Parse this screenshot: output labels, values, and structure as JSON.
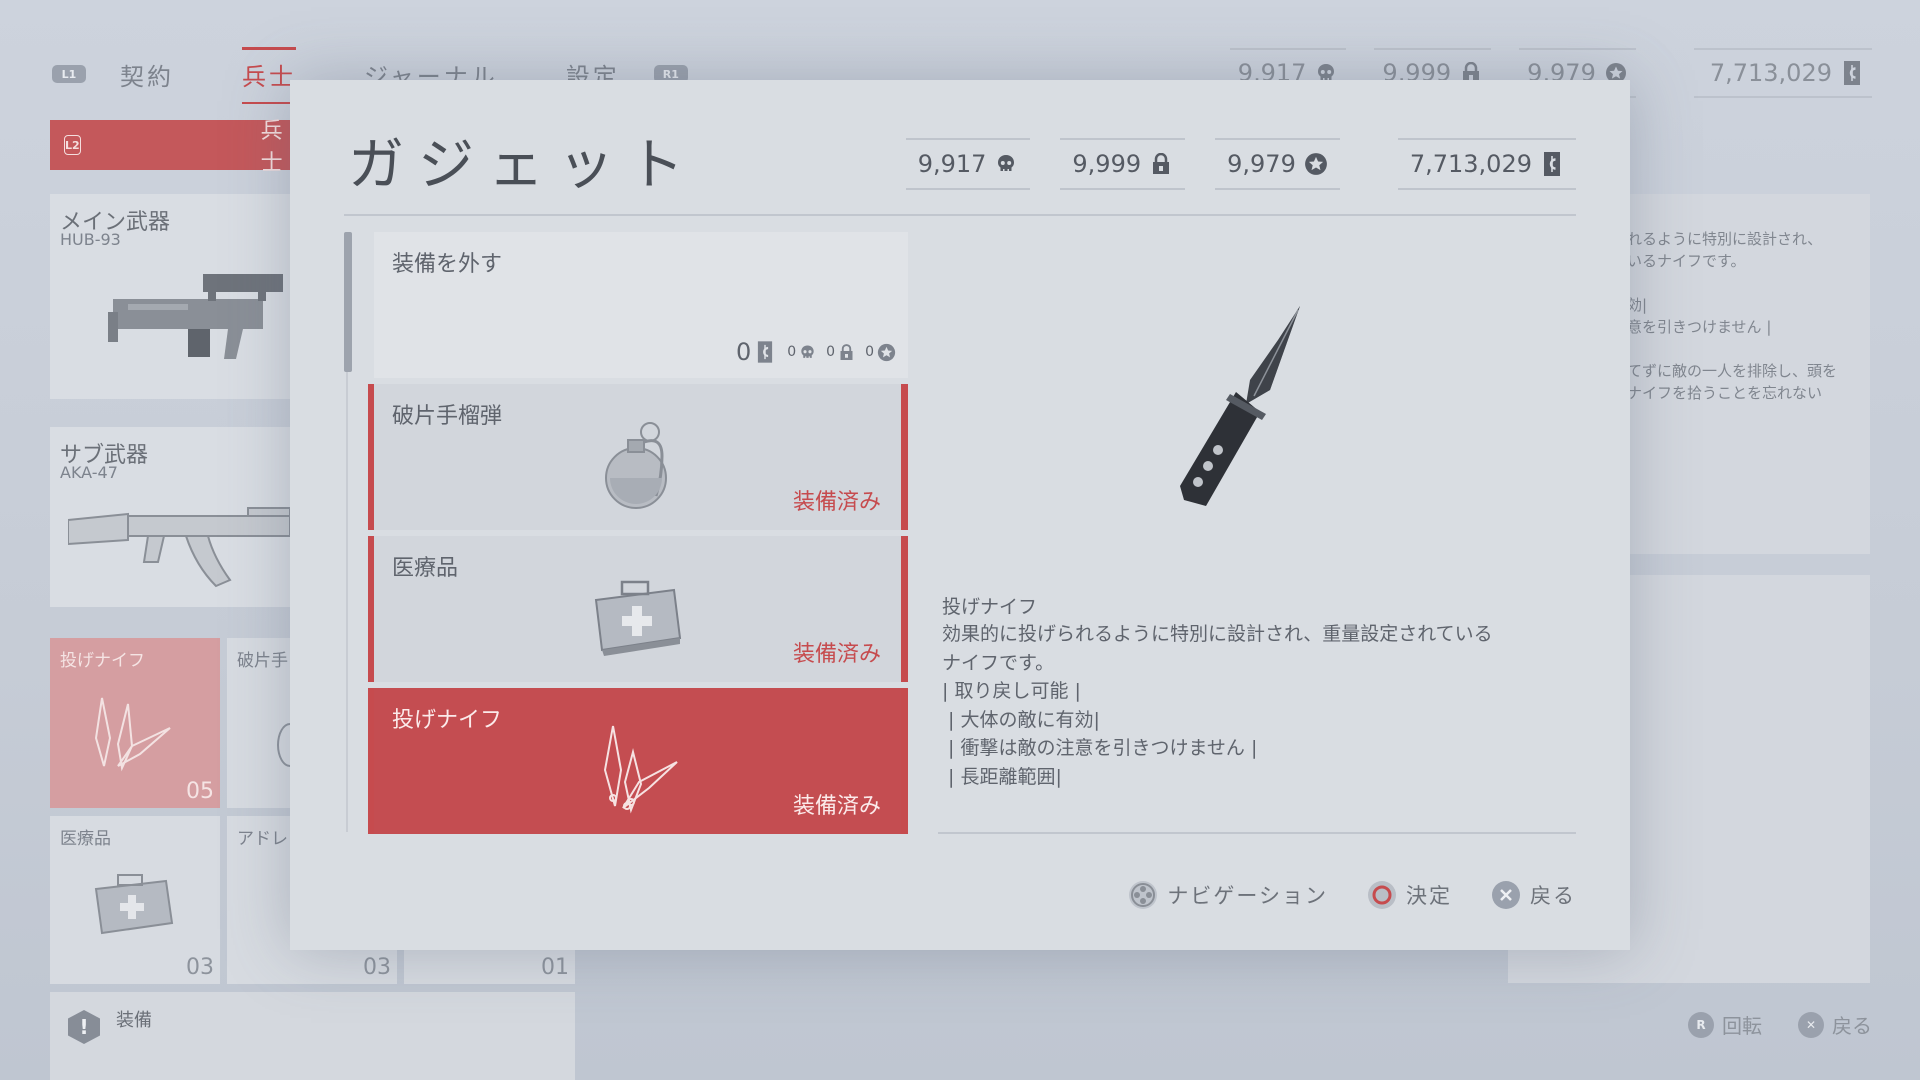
{
  "top_nav": {
    "l1": "L1",
    "r1": "R1",
    "tabs": [
      {
        "label": "契約"
      },
      {
        "label": "兵士"
      },
      {
        "label": "ジャーナル"
      },
      {
        "label": "設定"
      }
    ]
  },
  "currency": {
    "kills": "9,917",
    "locks": "9,999",
    "stars": "9,979",
    "credits": "7,713,029"
  },
  "bg": {
    "banner_button": "L2",
    "banner_label": "兵士",
    "main_weapon": {
      "title": "メイン武器",
      "name": "HUB-93"
    },
    "sub_weapon": {
      "title": "サブ武器",
      "name": "AKA-47"
    },
    "slots": [
      {
        "title": "投げナイフ",
        "count": "05"
      },
      {
        "title": "破片手",
        "count": ""
      },
      {
        "title": "医療品",
        "count": "03"
      },
      {
        "title": "アドレ",
        "count": "03"
      },
      {
        "title": "",
        "count": "01"
      }
    ],
    "status_mark": "!",
    "status_label": "装備",
    "right_desc": "れるように特別に設計され、\nいるナイフです。\n\n効|\n意を引きつけません |\n\nてずに敵の一人を排除し、頭を\nナイフを拾うことを忘れない",
    "hints": [
      {
        "button": "R",
        "label": "回転"
      },
      {
        "button": "✕",
        "label": "戻る"
      }
    ]
  },
  "modal": {
    "title": "ガジェット",
    "items": [
      {
        "label": "装備を外す",
        "cost_credits": "0",
        "cost_kills": "0",
        "cost_locks": "0",
        "cost_stars": "0"
      },
      {
        "label": "破片手榴弾",
        "status": "装備済み"
      },
      {
        "label": "医療品",
        "status": "装備済み"
      },
      {
        "label": "投げナイフ",
        "status": "装備済み"
      }
    ],
    "detail": {
      "name": "投げナイフ",
      "lines": [
        "効果的に投げられるように特別に設計され、重量設定されている",
        "ナイフです。",
        "| 取り戻し可能 |",
        " | 大体の敵に有効|",
        " | 衝撃は敵の注意を引きつけません |",
        " | 長距離範囲|"
      ]
    },
    "hints": [
      {
        "label": "ナビゲーション"
      },
      {
        "label": "決定"
      },
      {
        "label": "戻る"
      }
    ]
  },
  "colors": {
    "accent": "#c64b4e",
    "background": "#c9cfd8",
    "panel": "#d9dde2"
  }
}
